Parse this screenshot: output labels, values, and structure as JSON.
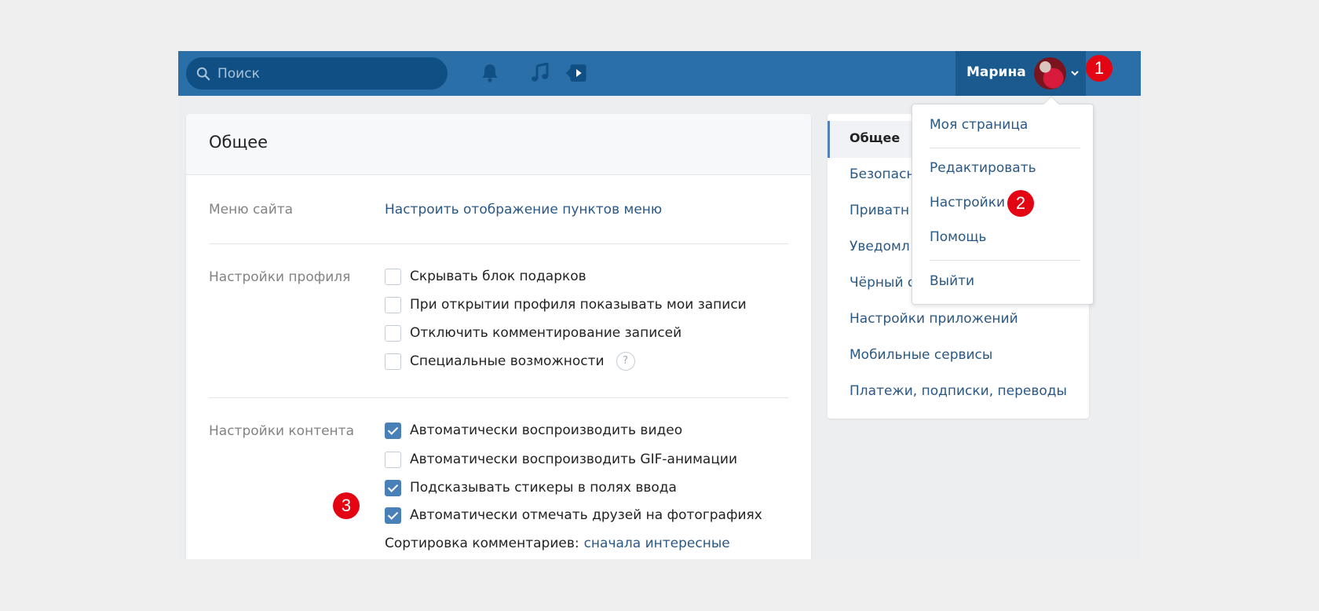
{
  "header": {
    "search_placeholder": "Поиск",
    "user_name": "Марина",
    "icons": [
      "search-icon",
      "bell-icon",
      "music-icon",
      "video-icon",
      "chevron-down-icon"
    ]
  },
  "markers": [
    "1",
    "2",
    "3"
  ],
  "card": {
    "title": "Общее",
    "site_menu": {
      "label": "Меню сайта",
      "link": "Настроить отображение пунктов меню"
    },
    "profile": {
      "label": "Настройки профиля",
      "options": [
        {
          "text": "Скрывать блок подарков",
          "checked": false
        },
        {
          "text": "При открытии профиля показывать мои записи",
          "checked": false
        },
        {
          "text": "Отключить комментирование записей",
          "checked": false
        },
        {
          "text": "Специальные возможности",
          "checked": false
        }
      ],
      "help": "?"
    },
    "content": {
      "label": "Настройки контента",
      "options": [
        {
          "text": "Автоматически воспроизводить видео",
          "checked": true
        },
        {
          "text": "Автоматически воспроизводить GIF-анимации",
          "checked": false
        },
        {
          "text": "Подсказывать стикеры в полях ввода",
          "checked": true
        },
        {
          "text": "Автоматически отмечать друзей на фотографиях",
          "checked": true
        }
      ],
      "sort_label": "Сортировка комментариев:",
      "sort_value": "сначала интересные"
    }
  },
  "side_menu": {
    "items": [
      "Общее",
      "Безопасн",
      "Приватн",
      "Уведомл",
      "Чёрный с",
      "Настройки приложений",
      "Мобильные сервисы",
      "Платежи, подписки, переводы"
    ]
  },
  "dropdown": {
    "items": [
      "Моя страница",
      "Редактировать",
      "Настройки",
      "Помощь",
      "Выйти"
    ]
  },
  "colors": {
    "header": "#2a6fa8",
    "search": "#0f4f84",
    "link": "#2a5885",
    "marker": "#e30513",
    "checkbox_on": "#4a80b8"
  }
}
